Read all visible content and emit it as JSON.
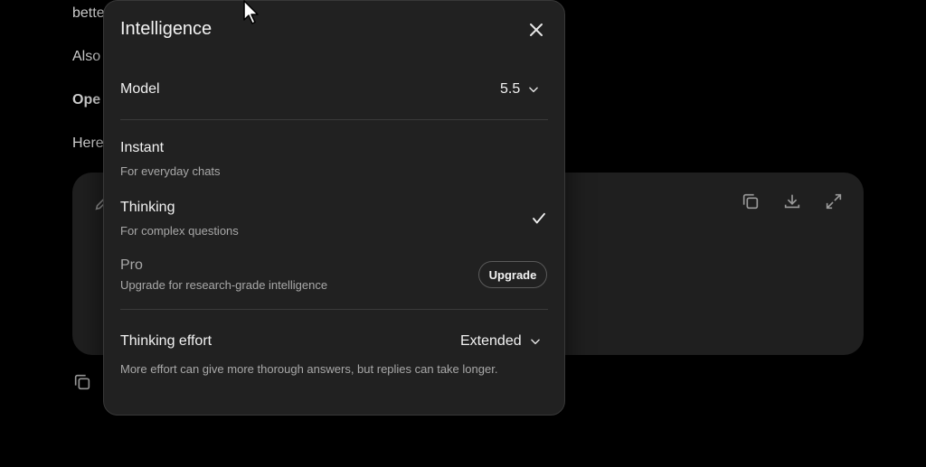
{
  "background": {
    "lines": [
      "bette",
      "Also",
      "Ope",
      "Here"
    ]
  },
  "modal": {
    "title": "Intelligence",
    "model": {
      "label": "Model",
      "value": "5.5"
    },
    "options": [
      {
        "label": "Instant",
        "description": "For everyday chats",
        "selected": false
      },
      {
        "label": "Thinking",
        "description": "For complex questions",
        "selected": true
      },
      {
        "label": "Pro",
        "description": "Upgrade for research-grade intelligence",
        "selected": false,
        "action": "Upgrade"
      }
    ],
    "effort": {
      "label": "Thinking effort",
      "value": "Extended",
      "description": "More effort can give more thorough answers, but replies can take longer."
    }
  },
  "colors": {
    "page_bg": "#000000",
    "modal_bg": "#212121",
    "card_bg": "#1f1f1f",
    "muted_text": "#a8a8a8"
  }
}
